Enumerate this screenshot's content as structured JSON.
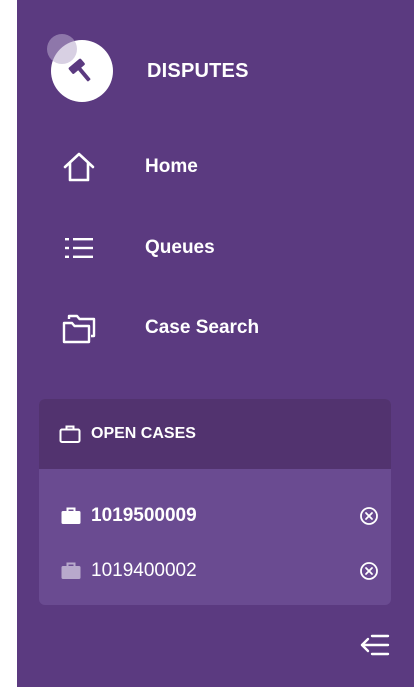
{
  "app": {
    "title": "DISPUTES",
    "logo_icon": "gavel-icon"
  },
  "nav": [
    {
      "label": "Home",
      "icon": "home-icon"
    },
    {
      "label": "Queues",
      "icon": "list-icon"
    },
    {
      "label": "Case Search",
      "icon": "folders-icon"
    }
  ],
  "open_cases": {
    "header": "OPEN CASES",
    "items": [
      {
        "id": "1019500009",
        "active": true
      },
      {
        "id": "1019400002",
        "active": false
      }
    ]
  },
  "colors": {
    "sidebar_bg": "#5b3a80",
    "panel_bg": "#6a4b91",
    "panel_header_bg": "#52336f",
    "text": "#ffffff",
    "inactive_case_icon": "#b8a9cc"
  }
}
